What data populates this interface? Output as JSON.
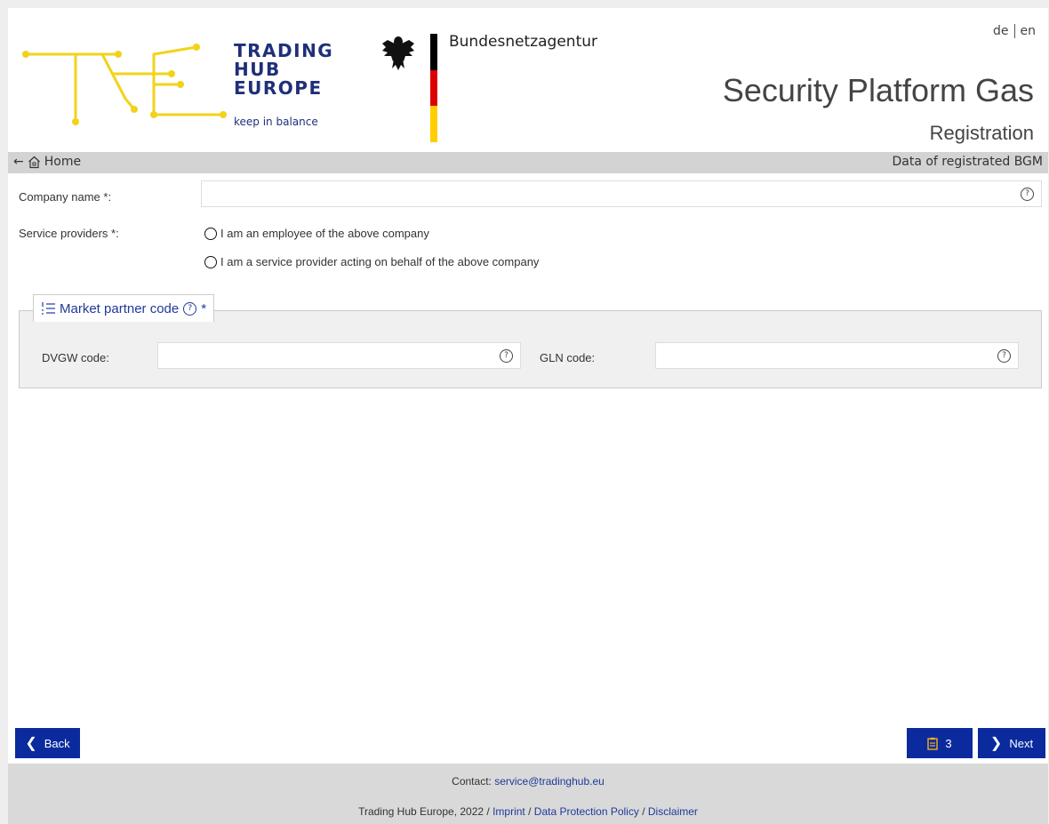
{
  "header": {
    "brand_line1": "TRADING",
    "brand_line2": "HUB",
    "brand_line3": "EUROPE",
    "brand_tagline": "keep in balance",
    "agency": "Bundesnetzagentur",
    "lang_de": "de",
    "lang_en": "en",
    "app_title": "Security Platform Gas",
    "page_subtitle": "Registration"
  },
  "nav": {
    "home_label": "Home",
    "step_label": "Data of registrated BGM"
  },
  "form": {
    "company_label": "Company name *:",
    "company_value": "",
    "service_label": "Service providers *:",
    "radio_employee": "I am an employee of the above company",
    "radio_provider": "I am a service provider acting on behalf of the above company",
    "market_partner_legend": "Market partner code",
    "required_star": "*",
    "dvgw_label": "DVGW code:",
    "dvgw_value": "",
    "gln_label": "GLN code:",
    "gln_value": "",
    "help_glyph": "?"
  },
  "actions": {
    "back_label": "Back",
    "count_label": "3",
    "next_label": "Next"
  },
  "footer": {
    "contact_prefix": "Contact:",
    "contact_email": "service@tradinghub.eu",
    "copyright": "Trading Hub Europe, 2022 /",
    "imprint": "Imprint",
    "separator": "/",
    "privacy": "Data Protection Policy",
    "disclaimer": "Disclaimer"
  },
  "colors": {
    "brand_blue": "#1f2f7a",
    "button_blue": "#0a2a9e",
    "logo_yellow": "#f2d31b",
    "nav_grey": "#d3d3d3"
  }
}
